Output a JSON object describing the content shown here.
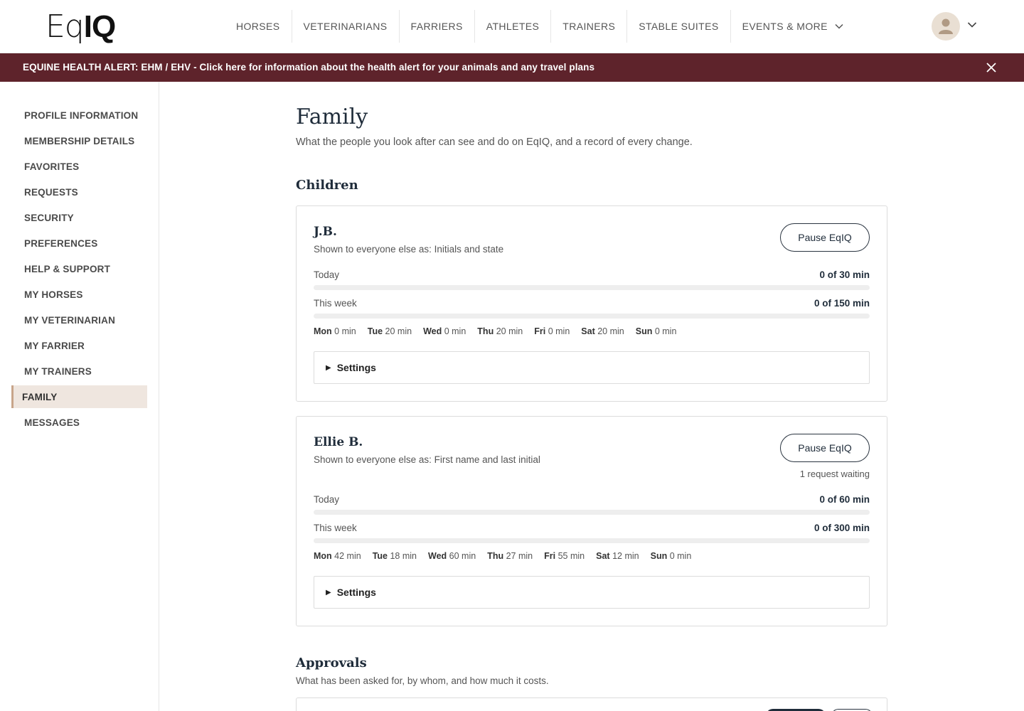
{
  "header": {
    "logo_part1": "Eq",
    "logo_part2": "IQ",
    "nav": [
      "HORSES",
      "VETERINARIANS",
      "FARRIERS",
      "ATHLETES",
      "TRAINERS",
      "STABLE SUITES",
      "EVENTS & MORE"
    ]
  },
  "alert": {
    "text": "EQUINE HEALTH ALERT: EHM / EHV - Click here for information about the health alert for your animals and any travel plans"
  },
  "sidebar": {
    "items": [
      {
        "label": "PROFILE INFORMATION",
        "active": false
      },
      {
        "label": "MEMBERSHIP DETAILS",
        "active": false
      },
      {
        "label": "FAVORITES",
        "active": false
      },
      {
        "label": "REQUESTS",
        "active": false
      },
      {
        "label": "SECURITY",
        "active": false
      },
      {
        "label": "PREFERENCES",
        "active": false
      },
      {
        "label": "HELP & SUPPORT",
        "active": false
      },
      {
        "label": "MY HORSES",
        "active": false
      },
      {
        "label": "MY VETERINARIAN",
        "active": false
      },
      {
        "label": "MY FARRIER",
        "active": false
      },
      {
        "label": "MY TRAINERS",
        "active": false
      },
      {
        "label": "FAMILY",
        "active": true
      },
      {
        "label": "MESSAGES",
        "active": false
      }
    ]
  },
  "main": {
    "title": "Family",
    "subtitle": "What the people you look after can see and do on EqIQ, and a record of every change.",
    "children_heading": "Children",
    "children": [
      {
        "name": "J.B.",
        "shown_as": "Shown to everyone else as: Initials and state",
        "pause_label": "Pause EqIQ",
        "request_waiting": "",
        "today_label": "Today",
        "today_value": "0 of 30 min",
        "today_fraction": 0,
        "week_label": "This week",
        "week_value": "0 of 150 min",
        "week_fraction": 0,
        "days": [
          {
            "day": "Mon",
            "min": "0 min"
          },
          {
            "day": "Tue",
            "min": "20 min"
          },
          {
            "day": "Wed",
            "min": "0 min"
          },
          {
            "day": "Thu",
            "min": "20 min"
          },
          {
            "day": "Fri",
            "min": "0 min"
          },
          {
            "day": "Sat",
            "min": "20 min"
          },
          {
            "day": "Sun",
            "min": "0 min"
          }
        ],
        "settings_label": "Settings"
      },
      {
        "name": "Ellie B.",
        "shown_as": "Shown to everyone else as: First name and last initial",
        "pause_label": "Pause EqIQ",
        "request_waiting": "1 request waiting",
        "today_label": "Today",
        "today_value": "0 of 60 min",
        "today_fraction": 0,
        "week_label": "This week",
        "week_value": "0 of 300 min",
        "week_fraction": 0,
        "days": [
          {
            "day": "Mon",
            "min": "42 min"
          },
          {
            "day": "Tue",
            "min": "18 min"
          },
          {
            "day": "Wed",
            "min": "60 min"
          },
          {
            "day": "Thu",
            "min": "27 min"
          },
          {
            "day": "Fri",
            "min": "55 min"
          },
          {
            "day": "Sat",
            "min": "12 min"
          },
          {
            "day": "Sun",
            "min": "0 min"
          }
        ],
        "settings_label": "Settings"
      }
    ],
    "approvals_heading": "Approvals",
    "approvals_subtitle": "What has been asked for, by whom, and how much it costs."
  }
}
